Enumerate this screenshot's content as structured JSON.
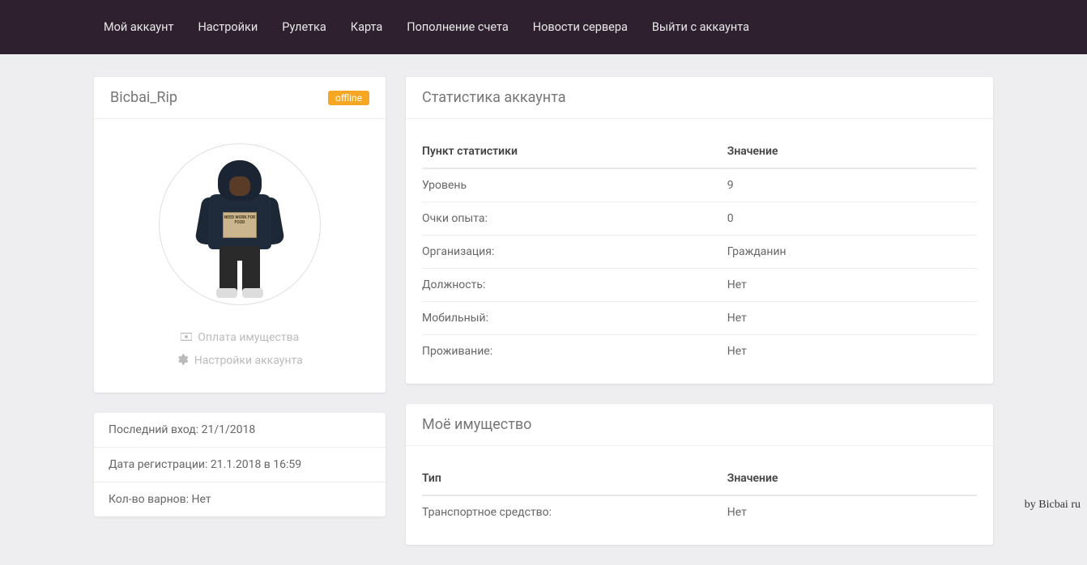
{
  "nav": {
    "items": [
      "Мой аккаунт",
      "Настройки",
      "Рулетка",
      "Карта",
      "Пополнение счета",
      "Новости сервера",
      "Выйти с аккаунта"
    ]
  },
  "profile": {
    "username": "Bicbai_Rip",
    "status_badge": "offline",
    "avatar_sign_text": "NEED WORK FOR FOOD",
    "links": {
      "pay_property": "Оплата имущества",
      "account_settings": "Настройки аккаунта"
    }
  },
  "info_list": [
    "Последний вход: 21/1/2018",
    "Дата регистрации: 21.1.2018 в 16:59",
    "Кол-во варнов: Нет"
  ],
  "stats_panel": {
    "title": "Статистика аккаунта",
    "columns": {
      "label": "Пункт статистики",
      "value": "Значение"
    },
    "rows": [
      {
        "label": "Уровень",
        "value": "9"
      },
      {
        "label": "Очки опыта:",
        "value": "0"
      },
      {
        "label": "Организация:",
        "value": "Гражданин"
      },
      {
        "label": "Должность:",
        "value": "Нет"
      },
      {
        "label": "Мобильный:",
        "value": "Нет"
      },
      {
        "label": "Проживание:",
        "value": "Нет"
      }
    ]
  },
  "property_panel": {
    "title": "Моё имущество",
    "columns": {
      "label": "Тип",
      "value": "Значение"
    },
    "rows": [
      {
        "label": "Транспортное средство:",
        "value": "Нет"
      }
    ]
  },
  "watermark": "by Bicbai ru"
}
